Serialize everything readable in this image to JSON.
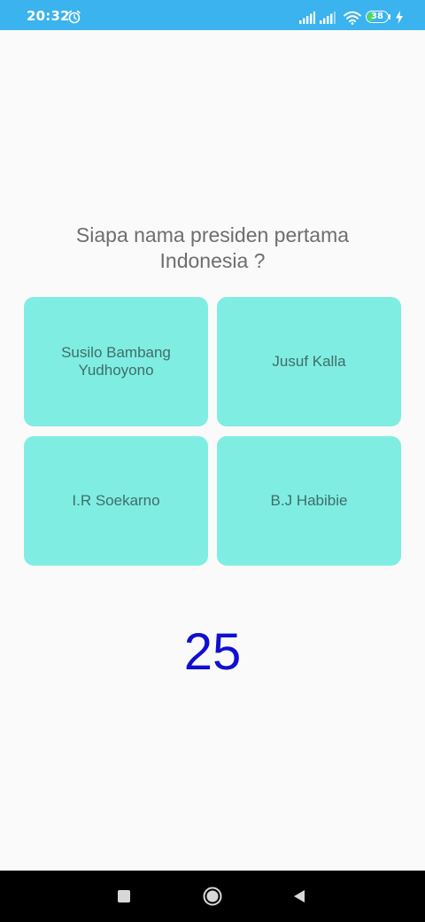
{
  "status_bar": {
    "time": "20:32",
    "battery_level": "38",
    "battery_fraction": 0.38,
    "icons": [
      "alarm-icon",
      "signal-icon",
      "signal-icon",
      "wifi-icon",
      "battery-icon",
      "charging-icon"
    ],
    "background": "#3ab3ee"
  },
  "quiz": {
    "question": "Siapa nama presiden pertama Indonesia ?",
    "options": [
      {
        "label": "Susilo Bambang Yudhoyono"
      },
      {
        "label": "Jusuf Kalla"
      },
      {
        "label": "I.R Soekarno"
      },
      {
        "label": "B.J Habibie"
      }
    ],
    "option_color": "#80ede3",
    "timer": "25",
    "timer_color": "#1010d0"
  },
  "nav_bar": {
    "buttons": [
      "recent-apps-icon",
      "home-icon",
      "back-icon"
    ]
  }
}
